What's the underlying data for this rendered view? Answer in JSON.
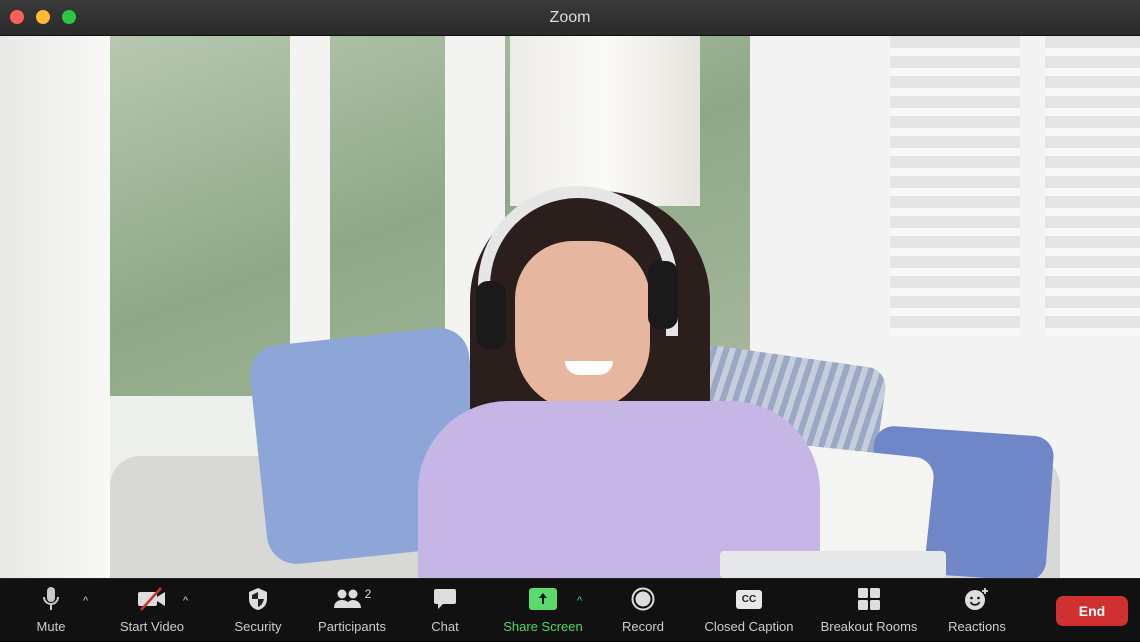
{
  "window": {
    "title": "Zoom"
  },
  "colors": {
    "accent_green": "#4cd964",
    "end_red": "#d03030"
  },
  "toolbar": {
    "mute": "Mute",
    "start_video": "Start Video",
    "security": "Security",
    "participants": "Participants",
    "participants_count": "2",
    "chat": "Chat",
    "share_screen": "Share Screen",
    "record": "Record",
    "closed_caption": "Closed Caption",
    "cc_glyph": "CC",
    "breakout_rooms": "Breakout Rooms",
    "reactions": "Reactions",
    "end": "End"
  }
}
